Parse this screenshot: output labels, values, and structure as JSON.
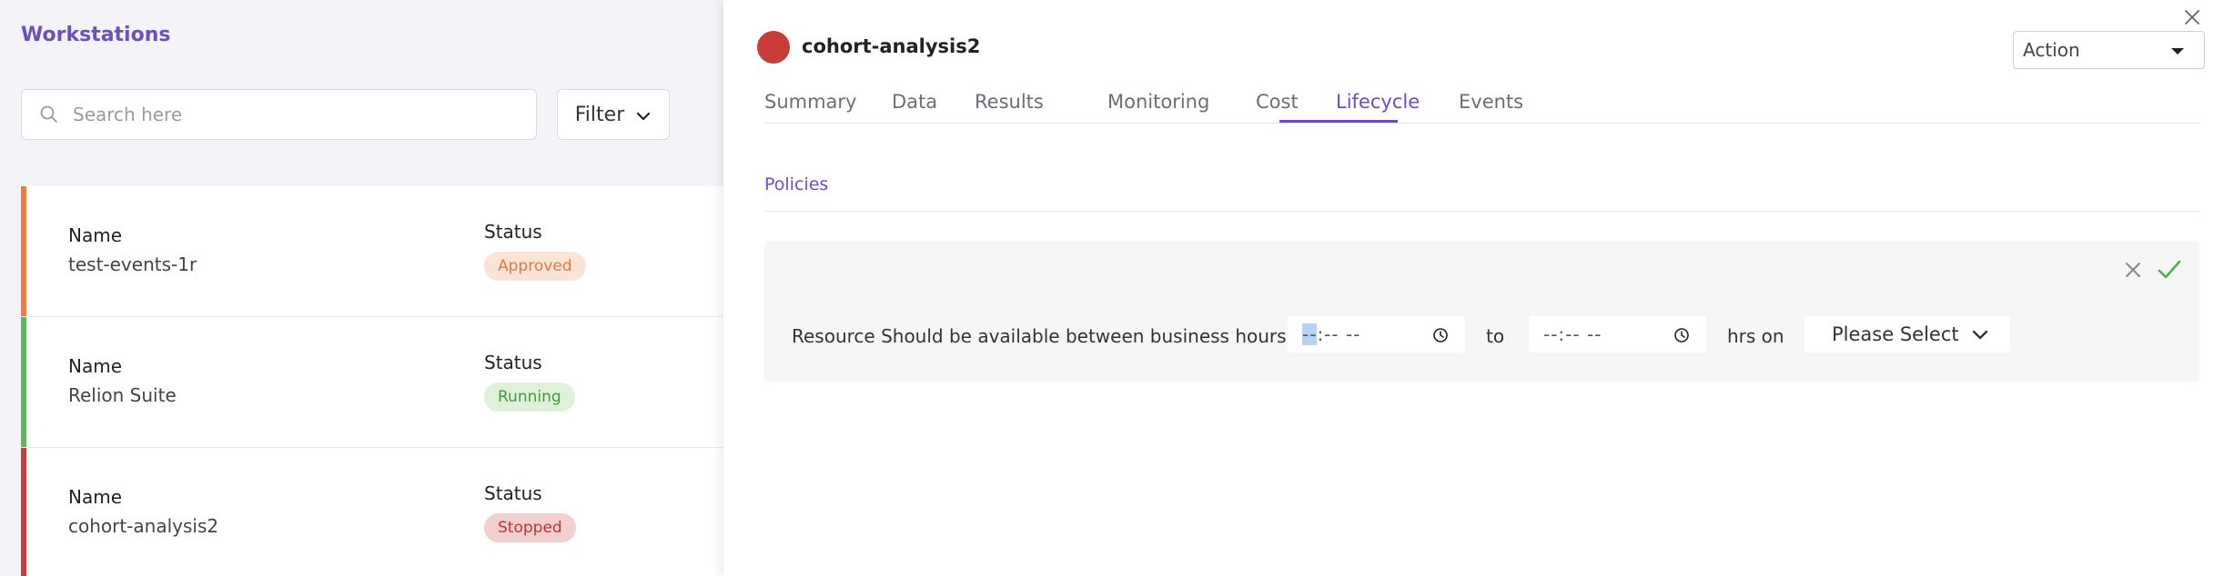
{
  "left_panel": {
    "title": "Workstations",
    "search_placeholder": "Search here",
    "filter_label": "Filter",
    "items": [
      {
        "name_label": "Name",
        "name": "test-events-1r",
        "status_label": "Status",
        "status": "Approved",
        "accent": "#f07b3f",
        "badge_bg": "#fbe3d5",
        "badge_color": "#e07a45"
      },
      {
        "name_label": "Name",
        "name": "Relion Suite",
        "status_label": "Status",
        "status": "Running",
        "accent": "#5cb85c",
        "badge_bg": "#dff1d8",
        "badge_color": "#3f9b3b"
      },
      {
        "name_label": "Name",
        "name": "cohort-analysis2",
        "status_label": "Status",
        "status": "Stopped",
        "accent": "#c93c38",
        "badge_bg": "#f4cfcf",
        "badge_color": "#c3332f"
      }
    ]
  },
  "detail": {
    "workstation_name": "cohort-analysis2",
    "status_color": "#c93c38",
    "action_label": "Action",
    "tabs": [
      "Summary",
      "Data",
      "Results",
      "Monitoring",
      "Cost",
      "Lifecycle",
      "Events"
    ],
    "active_tab": "Lifecycle",
    "section_title": "Policies",
    "policy": {
      "text": "Resource Should be available between business hours",
      "start_time_highlight": "--",
      "start_time_rest": ":-- --",
      "end_time": "--:-- --",
      "to_label": "to",
      "hrs_label": "hrs on",
      "select_label": "Please Select"
    }
  },
  "colors": {
    "accent": "#6d4fbf",
    "confirm": "#4caf50"
  }
}
